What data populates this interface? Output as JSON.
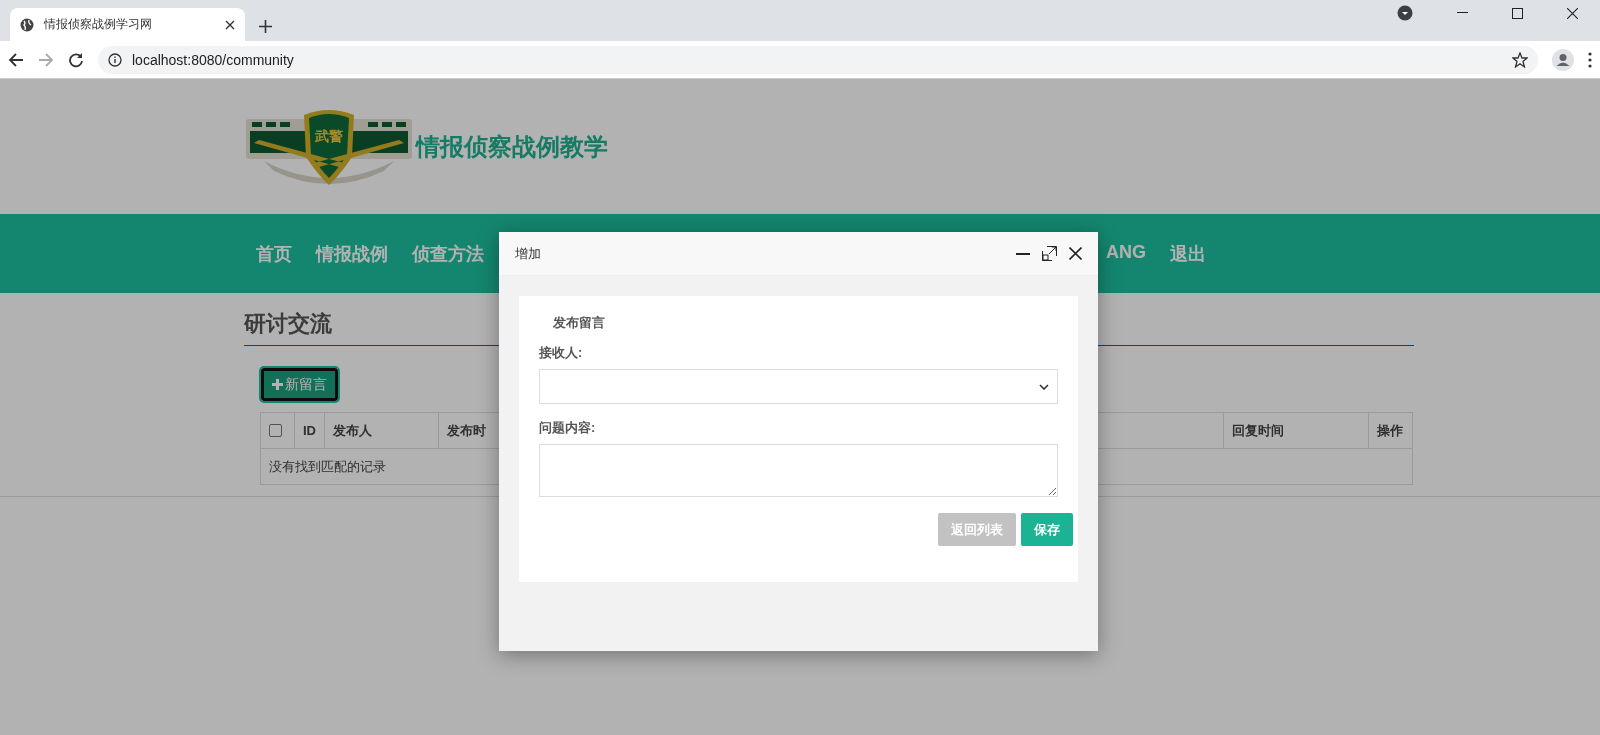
{
  "browser": {
    "tab_title": "情报侦察战例学习网",
    "url": "localhost:8080/community"
  },
  "site": {
    "logo_text": "武警",
    "title": "情报侦察战例教学"
  },
  "nav": {
    "items_left": [
      {
        "label": "首页"
      },
      {
        "label": "情报战例"
      },
      {
        "label": "侦查方法"
      }
    ],
    "items_right": [
      {
        "label": "ANG"
      },
      {
        "label": "退出"
      }
    ]
  },
  "section_title": "研讨交流",
  "new_button": "新留言",
  "table": {
    "select_all_checked": false,
    "columns": [
      "ID",
      "发布人",
      "发布时",
      "回复时间",
      "操作"
    ],
    "empty_message": "没有找到匹配的记录"
  },
  "dialog": {
    "title": "增加",
    "heading": "发布留言",
    "fields": [
      {
        "kind": "select",
        "label": "接收人:"
      },
      {
        "kind": "textarea",
        "label": "问题内容:"
      }
    ],
    "buttons": [
      {
        "label": "返回列表",
        "kind": "secondary"
      },
      {
        "label": "保存",
        "kind": "primary"
      }
    ]
  }
}
